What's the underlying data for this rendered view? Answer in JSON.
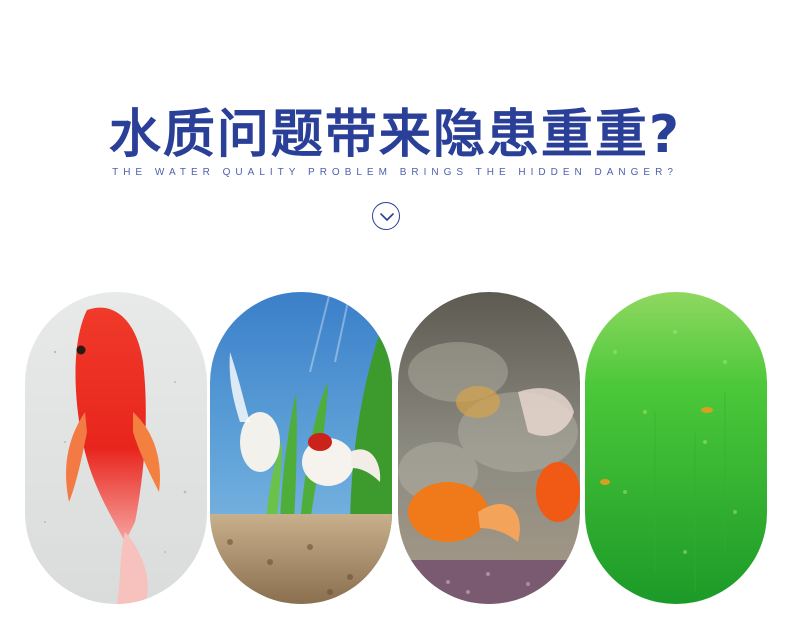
{
  "heading": {
    "title": "水质问题带来隐患重重?",
    "subtitle": "THE WATER QUALITY PROBLEM BRINGS THE HIDDEN DANGER?"
  },
  "scroll_icon": "chevron-down-circle-icon",
  "colors": {
    "title": "#2a3f97",
    "subtitle": "#4d5fb0"
  },
  "photos": [
    {
      "name": "diseased-red-goldfish-photo"
    },
    {
      "name": "goldfish-aquarium-plants-photo"
    },
    {
      "name": "cloudy-water-goldfish-photo"
    },
    {
      "name": "green-algae-water-photo"
    }
  ]
}
